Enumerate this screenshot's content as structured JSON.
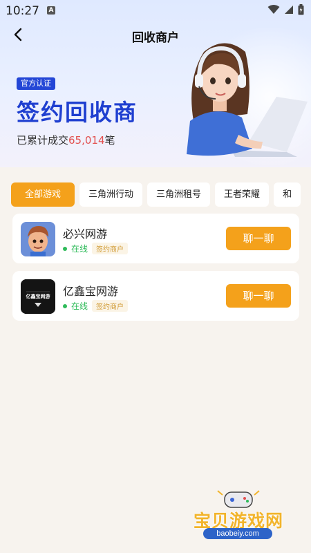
{
  "status_bar": {
    "time": "10:27",
    "a_badge": "A"
  },
  "nav": {
    "title": "回收商户"
  },
  "hero": {
    "tag": "官方认证",
    "title": "签约回收商",
    "deal_prefix": "已累计成交",
    "deal_count": "65,014",
    "deal_suffix": "笔"
  },
  "tabs": [
    {
      "label": "全部游戏",
      "active": true
    },
    {
      "label": "三角洲行动",
      "active": false
    },
    {
      "label": "三角洲租号",
      "active": false
    },
    {
      "label": "王者荣耀",
      "active": false
    },
    {
      "label": "和",
      "active": false
    }
  ],
  "merchants": [
    {
      "name": "必兴网游",
      "status": "在线",
      "badge": "签约商户",
      "button": "聊一聊",
      "logo_text": ""
    },
    {
      "name": "亿鑫宝网游",
      "status": "在线",
      "badge": "签约商户",
      "button": "聊一聊",
      "logo_text": "亿鑫宝网游"
    }
  ],
  "watermark": {
    "text": "宝贝游戏网",
    "url": "baobeiy.com"
  },
  "colors": {
    "accent": "#f4a11b",
    "brand_blue": "#1f3fd0",
    "online_green": "#2fbb5a",
    "count_red": "#e2504f"
  }
}
